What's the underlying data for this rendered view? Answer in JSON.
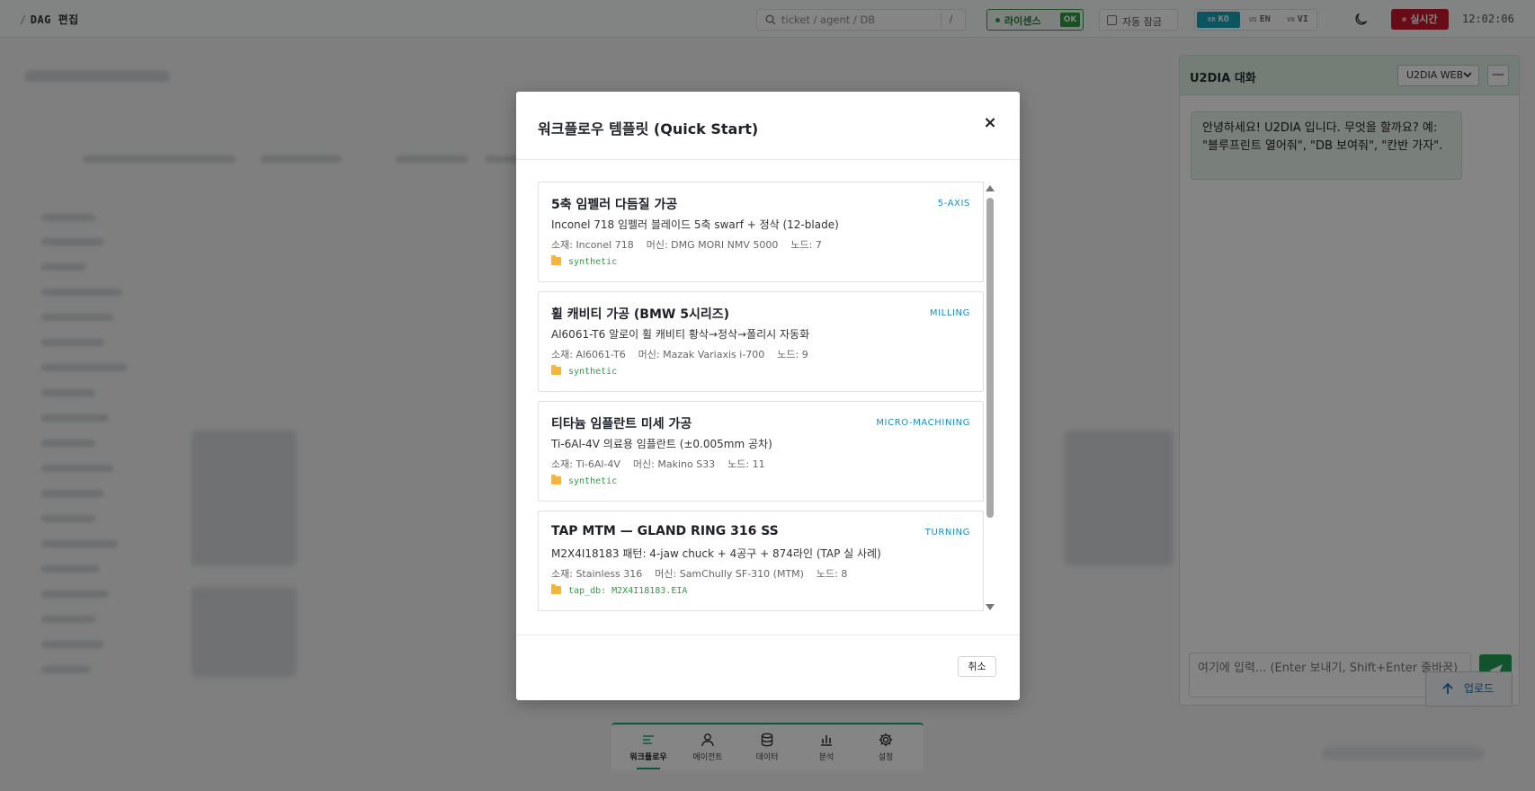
{
  "topbar": {
    "breadcrumb_sep": "/",
    "breadcrumb": "DAG 편집",
    "search_placeholder": "ticket / agent / DB",
    "search_shortcut": "/",
    "license_label": "라이센스",
    "license_status": "OK",
    "auto_lock_label": "자동 잠금",
    "languages": [
      {
        "flag": "KR",
        "code": "KO",
        "active": true
      },
      {
        "flag": "US",
        "code": "EN",
        "active": false
      },
      {
        "flag": "VN",
        "code": "VI",
        "active": false
      }
    ],
    "realtime_label": "실시간",
    "clock": "12:02:06"
  },
  "chat": {
    "title": "U2DIA 대화",
    "mode_select": "U2DIA WEB",
    "minimize_label": "—",
    "greeting": "안녕하세요! U2DIA 입니다. 무엇을 할까요? 예: \"블루프린트 열어줘\", \"DB 보여줘\", \"칸반 가자\".",
    "input_placeholder": "여기에 입력... (Enter 보내기, Shift+Enter 줄바꿈)",
    "upload_label": "업로드"
  },
  "bottom_nav": [
    {
      "label": "워크플로우",
      "icon": "workflow-icon",
      "active": true
    },
    {
      "label": "에이전트",
      "icon": "agent-icon",
      "active": false
    },
    {
      "label": "데이터",
      "icon": "database-icon",
      "active": false
    },
    {
      "label": "분석",
      "icon": "chart-icon",
      "active": false
    },
    {
      "label": "설정",
      "icon": "gear-icon",
      "active": false
    }
  ],
  "modal": {
    "title": "워크플로우 템플릿 (Quick Start)",
    "close_label": "×",
    "cancel_label": "취소",
    "templates": [
      {
        "title": "5축 임펠러 다듬질 가공",
        "tag": "5-AXIS",
        "desc": "Inconel 718 임펠러 블레이드 5축 swarf + 정삭 (12-blade)",
        "meta": "소재: Inconel 718    머신: DMG MORI NMV 5000    노드: 7",
        "source": "synthetic"
      },
      {
        "title": "휠 캐비티 가공 (BMW 5시리즈)",
        "tag": "MILLING",
        "desc": "Al6061-T6 알로이 휠 캐비티 황삭→정삭→폴리시 자동화",
        "meta": "소재: Al6061-T6    머신: Mazak Variaxis i-700    노드: 9",
        "source": "synthetic"
      },
      {
        "title": "티타늄 임플란트 미세 가공",
        "tag": "MICRO-MACHINING",
        "desc": "Ti-6Al-4V 의료용 임플란트 (±0.005mm 공차)",
        "meta": "소재: Ti-6Al-4V    머신: Makino S33    노드: 11",
        "source": "synthetic"
      },
      {
        "title": "TAP MTM — GLAND RING 316 SS",
        "tag": "TURNING",
        "desc": "M2X4I18183 패턴: 4-jaw chuck + 4공구 + 874라인 (TAP 실 사례)",
        "meta": "소재: Stainless 316    머신: SamChully SF-310 (MTM)    노드: 8",
        "source": "tap_db: M2X4I18183.EIA"
      }
    ]
  },
  "colors": {
    "accent_green": "#16a37f",
    "tag_blue": "#1a8fc4",
    "source_green": "#2e9e44",
    "realtime_red": "#c7192f",
    "lang_active": "#17a2b8"
  }
}
